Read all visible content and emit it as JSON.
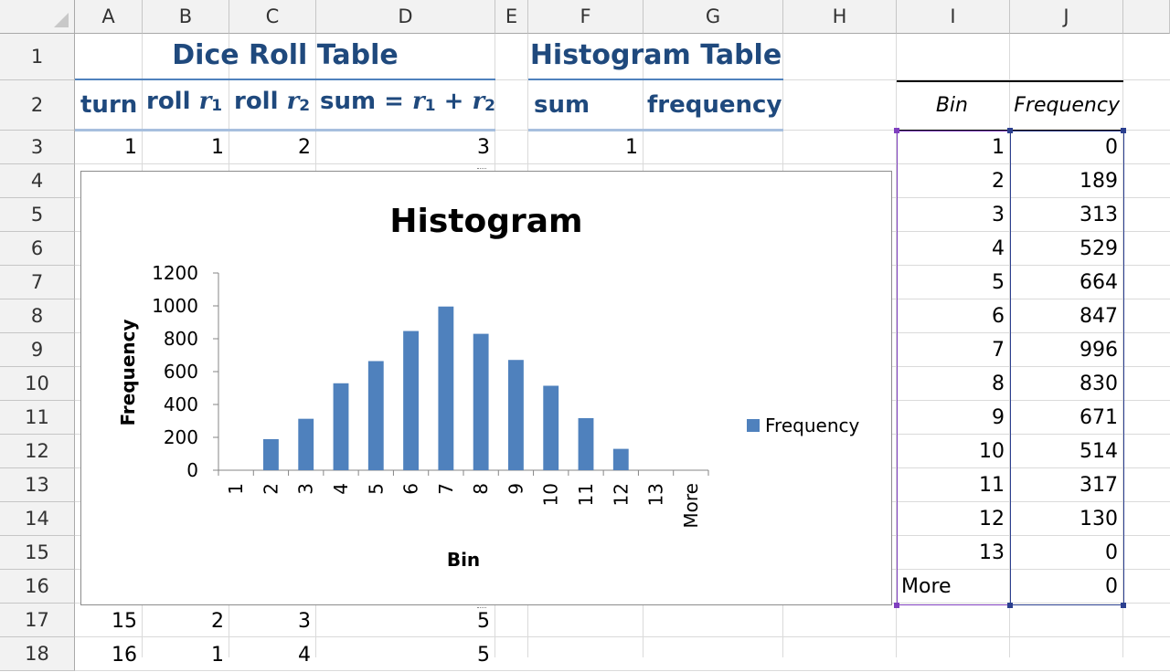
{
  "columns": [
    "A",
    "B",
    "C",
    "D",
    "E",
    "F",
    "G",
    "H",
    "I",
    "J"
  ],
  "rows": [
    "1",
    "2",
    "3",
    "4",
    "5",
    "6",
    "7",
    "8",
    "9",
    "10",
    "11",
    "12",
    "13",
    "14",
    "15",
    "16",
    "17",
    "18"
  ],
  "dice_table": {
    "title": "Dice Roll Table",
    "headers": {
      "turn": "turn",
      "roll1": "roll",
      "roll2": "roll",
      "sum": "sum =",
      "r": "r",
      "plus": "+",
      "sub1": "1",
      "sub2": "2"
    },
    "row3": {
      "turn": "1",
      "r1": "1",
      "r2": "2",
      "sum": "3"
    },
    "row17": {
      "turn": "15",
      "r1": "2",
      "r2": "3",
      "sum": "5"
    },
    "row18": {
      "turn": "16",
      "r1": "1",
      "r2": "4",
      "sum": "5"
    }
  },
  "hist_table": {
    "title": "Histogram Table",
    "headers": {
      "sum": "sum",
      "frequency": "frequency"
    },
    "row3_sum": "1"
  },
  "bin_table": {
    "headers": {
      "bin": "Bin",
      "frequency": "Frequency"
    },
    "bins": [
      "1",
      "2",
      "3",
      "4",
      "5",
      "6",
      "7",
      "8",
      "9",
      "10",
      "11",
      "12",
      "13",
      "More"
    ],
    "freqs": [
      "0",
      "189",
      "313",
      "529",
      "664",
      "847",
      "996",
      "830",
      "671",
      "514",
      "317",
      "130",
      "0",
      "0"
    ]
  },
  "colors": {
    "bar": "#4f81bd",
    "title_blue": "#1f497d",
    "header_border": "#a7bfde"
  },
  "chart_data": {
    "type": "bar",
    "title": "Histogram",
    "xlabel": "Bin",
    "ylabel": "Frequency",
    "categories": [
      "1",
      "2",
      "3",
      "4",
      "5",
      "6",
      "7",
      "8",
      "9",
      "10",
      "11",
      "12",
      "13",
      "More"
    ],
    "series": [
      {
        "name": "Frequency",
        "values": [
          0,
          189,
          313,
          529,
          664,
          847,
          996,
          830,
          671,
          514,
          317,
          130,
          0,
          0
        ]
      }
    ],
    "ylim": [
      0,
      1200
    ],
    "yticks": [
      "0",
      "200",
      "400",
      "600",
      "800",
      "1000",
      "1200"
    ],
    "legend": "right",
    "grid": false
  }
}
